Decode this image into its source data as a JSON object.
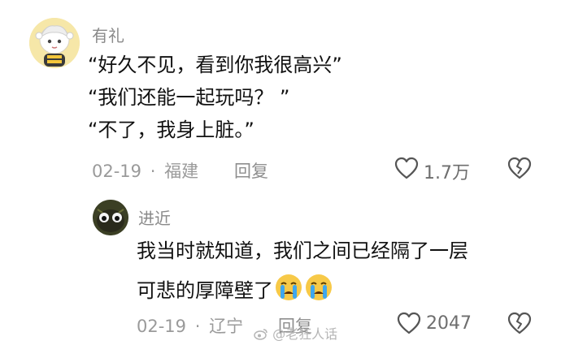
{
  "comment": {
    "username": "有礼",
    "lines": [
      "“好久不见，看到你我很高兴”",
      "“我们还能一起玩吗？ ”",
      "“不了，我身上脏。”"
    ],
    "date": "02-19",
    "separator": "·",
    "location": "福建",
    "reply_label": "回复",
    "likes": "1.7万"
  },
  "reply": {
    "username": "进近",
    "lines": [
      "我当时就知道，我们之间已经隔了一层",
      "可悲的厚障壁了"
    ],
    "emojis": [
      "crying-face",
      "crying-face"
    ],
    "date": "02-19",
    "separator": "·",
    "location": "辽宁",
    "reply_label": "回复",
    "likes": "2047"
  },
  "watermark": "@老狂人话",
  "colors": {
    "meta_text": "#9a9a9a",
    "icon_stroke": "#555555",
    "emoji_yellow": "#f7c948",
    "emoji_tear": "#3fa7ee"
  }
}
